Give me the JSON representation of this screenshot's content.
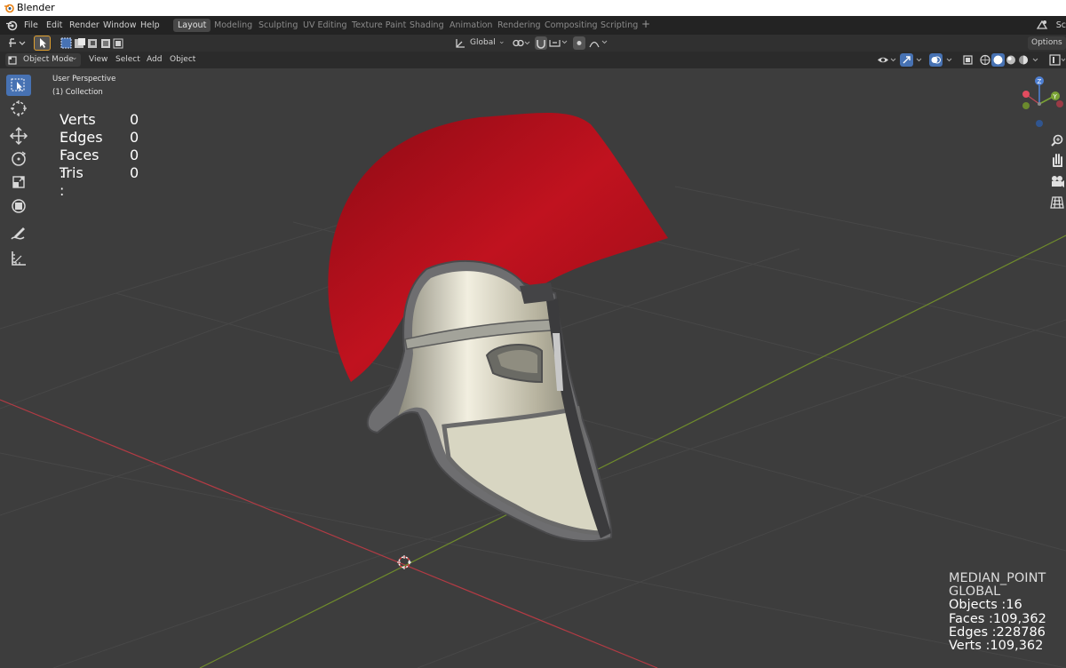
{
  "window": {
    "title": "Blender"
  },
  "menu": [
    "File",
    "Edit",
    "Render",
    "Window",
    "Help"
  ],
  "workspaces": [
    "Layout",
    "Modeling",
    "Sculpting",
    "UV Editing",
    "Texture Paint",
    "Shading",
    "Animation",
    "Rendering",
    "Compositing",
    "Scripting"
  ],
  "active_workspace": "Layout",
  "topright": {
    "scene_label": "Sc",
    "options_label": "Options"
  },
  "transform_orientation": "Global",
  "header": {
    "mode": "Object Mode",
    "view": "View",
    "select": "Select",
    "add": "Add",
    "object": "Object"
  },
  "viewport": {
    "perspective": "User Perspective",
    "collection": "(1) Collection"
  },
  "overlay_stats": [
    {
      "label": "Verts :",
      "value": "0"
    },
    {
      "label": "Edges :",
      "value": "0"
    },
    {
      "label": "Faces :",
      "value": "0"
    },
    {
      "label": "Tris :",
      "value": "0"
    }
  ],
  "bottom_stats": {
    "pivot": "MEDIAN_POINT",
    "orientation": "GLOBAL",
    "objects": "Objects :16",
    "faces": "Faces :109,362",
    "edges": "Edges :228786",
    "verts": "Verts :109,362"
  },
  "gizmo": {
    "z_label": "Z",
    "y_label": "Y"
  },
  "colors": {
    "accent": "#4772b3",
    "crest": "#b30f1c",
    "x_axis": "#b33b44",
    "y_axis": "#6f8b2c",
    "background": "#3d3d3d"
  }
}
